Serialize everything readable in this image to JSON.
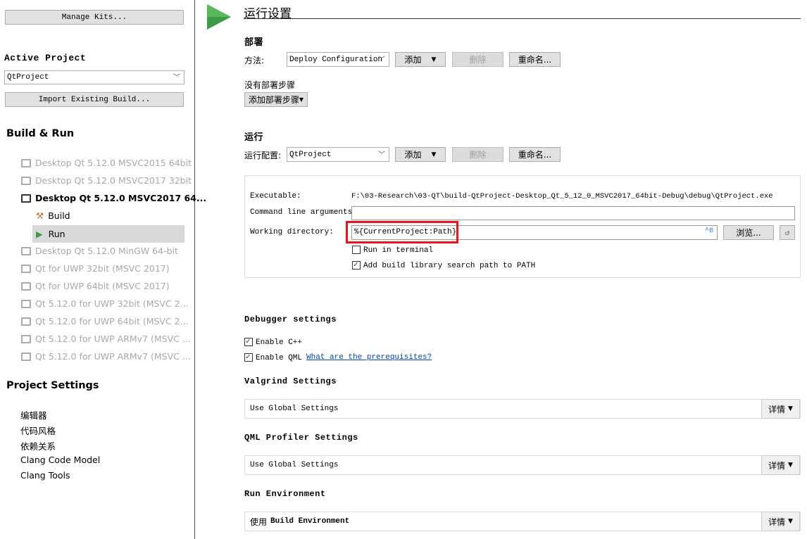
{
  "sidebar": {
    "manage_kits": "Manage Kits...",
    "active_project_label": "Active Project",
    "active_project_value": "QtProject",
    "import_build": "Import Existing Build...",
    "build_run_title": "Build & Run",
    "kits": [
      {
        "label": "Desktop Qt 5.12.0 MSVC2015 64bit",
        "icon": "monitor-warning-icon"
      },
      {
        "label": "Desktop Qt 5.12.0 MSVC2017 32bit",
        "icon": "monitor-add-icon"
      },
      {
        "label": "Desktop Qt 5.12.0 MSVC2017 64...",
        "icon": "monitor-icon"
      },
      {
        "label": "Desktop Qt 5.12.0 MinGW 64-bit",
        "icon": "monitor-add-icon"
      },
      {
        "label": "Qt  for UWP 32bit (MSVC 2017)",
        "icon": "monitor-add-icon"
      },
      {
        "label": "Qt  for UWP 64bit (MSVC 2017)",
        "icon": "monitor-add-icon"
      },
      {
        "label": "Qt 5.12.0 for UWP 32bit (MSVC 2...",
        "icon": "windows-icon"
      },
      {
        "label": "Qt 5.12.0 for UWP 64bit (MSVC 2...",
        "icon": "windows-icon"
      },
      {
        "label": "Qt 5.12.0 for UWP ARMv7 (MSVC ...",
        "icon": "windows-icon"
      },
      {
        "label": "Qt 5.12.0 for UWP ARMv7 (MSVC ...",
        "icon": "windows-icon"
      }
    ],
    "build": "Build",
    "run": "Run",
    "project_settings_title": "Project Settings",
    "settings": [
      "编辑器",
      "代码风格",
      "依赖关系",
      "Clang Code Model",
      "Clang Tools"
    ]
  },
  "main": {
    "title": "运行设置",
    "deploy": {
      "heading": "部署",
      "method_label": "方法:",
      "method_value": "Deploy Configuration",
      "add": "添加",
      "remove": "删除",
      "rename": "重命名...",
      "no_steps": "没有部署步骤",
      "add_step": "添加部署步骤"
    },
    "run": {
      "heading": "运行",
      "config_label": "运行配置:",
      "config_value": "QtProject",
      "add": "添加",
      "remove": "删除",
      "rename": "重命名..."
    },
    "executable_label": "Executable:",
    "executable_value": "F:\\03-Research\\03-QT\\build-QtProject-Desktop_Qt_5_12_0_MSVC2017_64bit-Debug\\debug\\QtProject.exe",
    "args_label": "Command line arguments:",
    "args_value": "",
    "workdir_label": "Working directory:",
    "workdir_value": "%{CurrentProject:Path}",
    "browse": "浏览...",
    "run_in_terminal": "Run in terminal",
    "run_in_terminal_checked": false,
    "add_lib_path": "Add build library search path to PATH",
    "add_lib_path_checked": true,
    "debugger_heading": "Debugger settings",
    "enable_cpp": "Enable C++",
    "enable_qml": "Enable QML",
    "prereq_link": "What are the prerequisites?",
    "valgrind_heading": "Valgrind Settings",
    "valgrind_value": "Use Global Settings",
    "qml_profiler_heading": "QML Profiler Settings",
    "qml_profiler_value": "Use Global Settings",
    "env_heading": "Run Environment",
    "env_prefix": "使用",
    "env_value": "Build Environment",
    "details": "详情",
    "highlight_color": "#e8141c",
    "accent_green": "#3c9a4a"
  }
}
